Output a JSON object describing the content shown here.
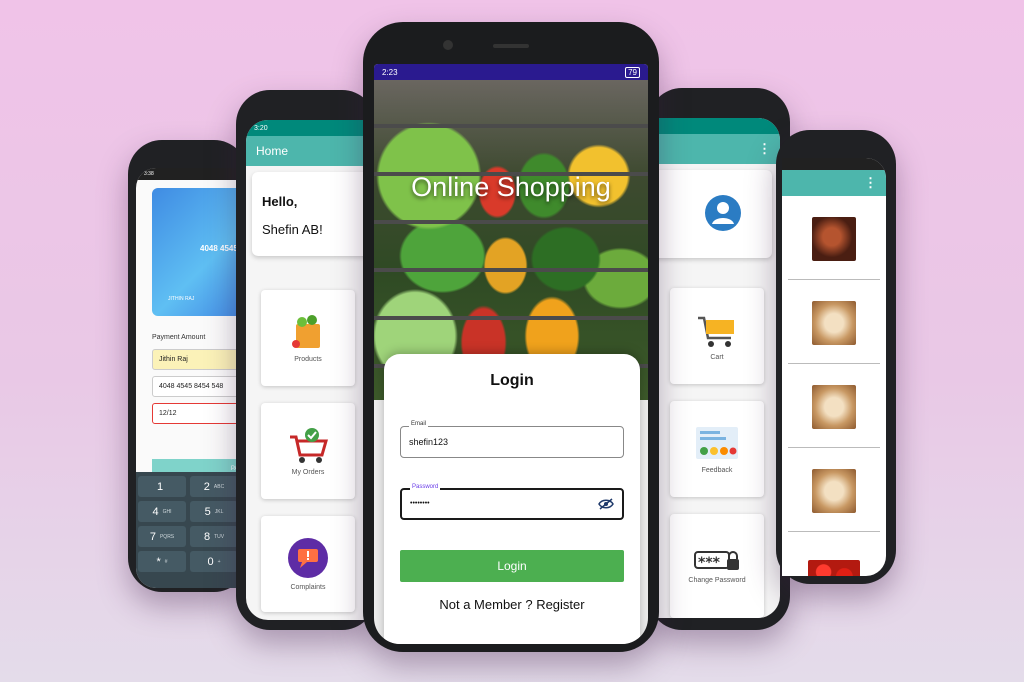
{
  "payment_phone": {
    "status_time": "3:38",
    "card_number": "4048 4545",
    "card_holder": "JITHIN RAJ",
    "amount_label": "Payment Amount",
    "fields": [
      "Jithin Raj",
      "4048 4545 8454 548",
      "12/12"
    ],
    "pay_label": "PAY",
    "keys": [
      {
        "digit": "1",
        "letters": ""
      },
      {
        "digit": "2",
        "letters": "ABC"
      },
      {
        "digit": "4",
        "letters": "GHI"
      },
      {
        "digit": "5",
        "letters": "JKL"
      },
      {
        "digit": "7",
        "letters": "PQRS"
      },
      {
        "digit": "8",
        "letters": "TUV"
      },
      {
        "digit": "*",
        "letters": "#"
      },
      {
        "digit": "0",
        "letters": "+"
      }
    ]
  },
  "home_phone": {
    "status_time": "3:20",
    "appbar_title": "Home",
    "greeting": "Hello,",
    "user_name": "Shefin AB!",
    "tiles": [
      "Products",
      "My Orders",
      "Complaints"
    ]
  },
  "login_phone": {
    "status_time": "2:23",
    "battery": "79",
    "hero_title": "Online Shopping",
    "login_title": "Login",
    "email_label": "Email",
    "email_value": "shefin123",
    "password_label": "Password",
    "password_value": "••••••••",
    "login_button": "Login",
    "register_text": "Not a Member ? Register"
  },
  "menu_phone": {
    "tiles": [
      "Cart",
      "Feedback",
      "Change Password"
    ],
    "password_glyph": "***"
  },
  "products_phone": {
    "thumbs": [
      "chick",
      "bread",
      "bread",
      "bread",
      "tom"
    ]
  },
  "colors": {
    "teal": "#4db6ac",
    "green": "#4caf50",
    "status_purple": "#2a1a8f"
  }
}
